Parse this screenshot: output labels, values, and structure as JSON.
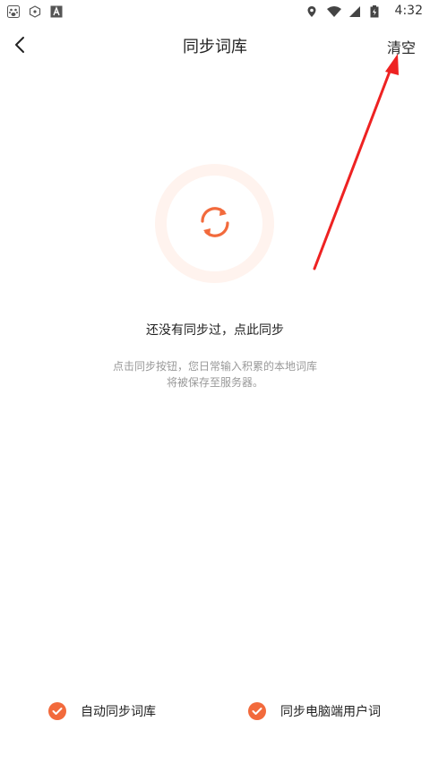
{
  "status_bar": {
    "time": "4:32",
    "icons_left": [
      "baidu-icon",
      "hexagon-icon",
      "a-box-icon"
    ],
    "icons_right": [
      "location-icon",
      "wifi-icon",
      "signal-icon",
      "battery-icon"
    ]
  },
  "nav": {
    "title": "同步词库",
    "clear_label": "清空"
  },
  "empty_state": {
    "title": "还没有同步过，点此同步",
    "desc_line1": "点击同步按钮，您日常输入积累的本地词库",
    "desc_line2": "将被保存至服务器。"
  },
  "options": {
    "auto_sync_label": "自动同步词库",
    "pc_sync_label": "同步电脑端用户词"
  },
  "colors": {
    "accent": "#f26a3c",
    "ring": "#fff3ee",
    "annotation": "#ee2222"
  }
}
